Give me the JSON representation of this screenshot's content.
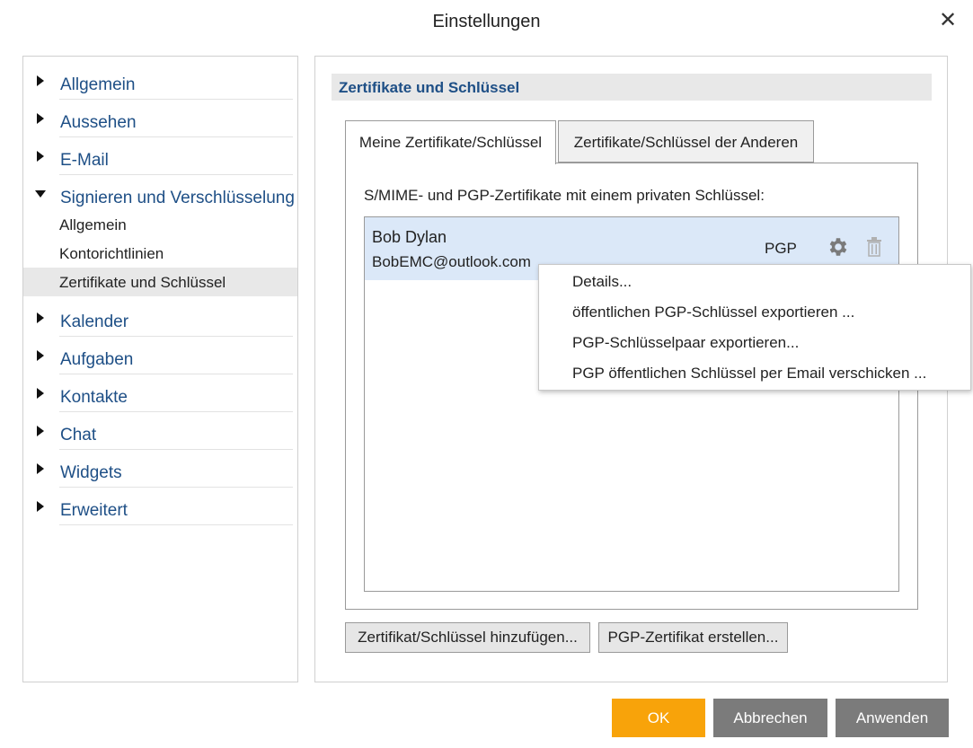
{
  "window": {
    "title": "Einstellungen"
  },
  "sidebar": {
    "items": [
      {
        "label": "Allgemein",
        "expanded": false
      },
      {
        "label": "Aussehen",
        "expanded": false
      },
      {
        "label": "E-Mail",
        "expanded": false
      },
      {
        "label": "Signieren und Verschlüsselung",
        "expanded": true,
        "children": [
          {
            "label": "Allgemein"
          },
          {
            "label": "Kontorichtlinien"
          },
          {
            "label": "Zertifikate und Schlüssel",
            "selected": true
          }
        ]
      },
      {
        "label": "Kalender",
        "expanded": false
      },
      {
        "label": "Aufgaben",
        "expanded": false
      },
      {
        "label": "Kontakte",
        "expanded": false
      },
      {
        "label": "Chat",
        "expanded": false
      },
      {
        "label": "Widgets",
        "expanded": false
      },
      {
        "label": "Erweitert",
        "expanded": false
      }
    ]
  },
  "main": {
    "section_title": "Zertifikate und Schlüssel",
    "tabs": [
      {
        "label": "Meine Zertifikate/Schlüssel",
        "active": true
      },
      {
        "label": "Zertifikate/Schlüssel der Anderen",
        "active": false
      }
    ],
    "list_label": "S/MIME- und PGP-Zertifikate mit einem privaten Schlüssel:",
    "certificates": [
      {
        "name": "Bob Dylan",
        "email": "BobEMC@outlook.com",
        "type": "PGP"
      }
    ],
    "add_button": "Zertifikat/Schlüssel hinzufügen...",
    "create_button": "PGP-Zertifikat erstellen..."
  },
  "context_menu": {
    "items": [
      {
        "label": "Details..."
      },
      {
        "label": "öffentlichen PGP-Schlüssel exportieren ..."
      },
      {
        "label": "PGP-Schlüsselpaar exportieren..."
      },
      {
        "label": "PGP öffentlichen Schlüssel per Email verschicken ..."
      }
    ]
  },
  "footer": {
    "ok": "OK",
    "cancel": "Abbrechen",
    "apply": "Anwenden"
  },
  "colors": {
    "accent": "#f8a30a",
    "nav_text": "#1e4f86",
    "selected_row": "#dbe8f8",
    "footer_gray": "#7b7b7b"
  },
  "icons": {
    "close": "close-icon",
    "expand": "triangle-right-icon",
    "collapse": "triangle-down-icon",
    "settings": "gear-icon",
    "delete": "trash-icon"
  }
}
